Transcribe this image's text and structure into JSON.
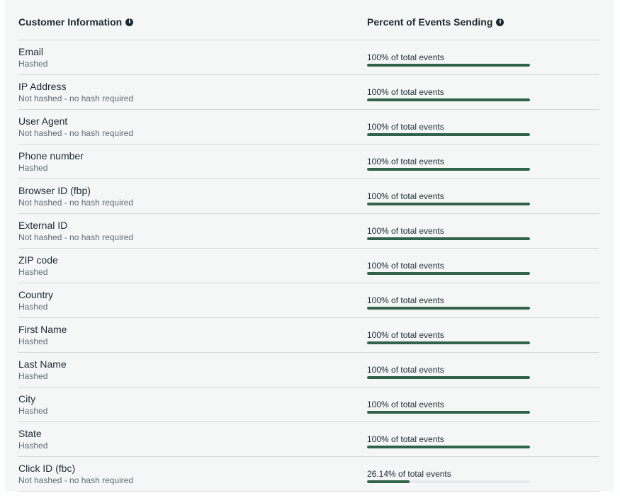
{
  "header": {
    "customer_information": "Customer Information",
    "percent_events_sending": "Percent of Events Sending"
  },
  "colors": {
    "bar_fill": "#31634a",
    "bar_track": "#e7e9eb",
    "panel_background": "#f5f6f6"
  },
  "rows": [
    {
      "name": "Email",
      "hash": "Hashed",
      "percent_text": "100% of total events",
      "fraction": 1.0
    },
    {
      "name": "IP Address",
      "hash": "Not hashed - no hash required",
      "percent_text": "100% of total events",
      "fraction": 1.0
    },
    {
      "name": "User Agent",
      "hash": "Not hashed - no hash required",
      "percent_text": "100% of total events",
      "fraction": 1.0
    },
    {
      "name": "Phone number",
      "hash": "Hashed",
      "percent_text": "100% of total events",
      "fraction": 1.0
    },
    {
      "name": "Browser ID (fbp)",
      "hash": "Not hashed - no hash required",
      "percent_text": "100% of total events",
      "fraction": 1.0
    },
    {
      "name": "External ID",
      "hash": "Not hashed - no hash required",
      "percent_text": "100% of total events",
      "fraction": 1.0
    },
    {
      "name": "ZIP code",
      "hash": "Hashed",
      "percent_text": "100% of total events",
      "fraction": 1.0
    },
    {
      "name": "Country",
      "hash": "Hashed",
      "percent_text": "100% of total events",
      "fraction": 1.0
    },
    {
      "name": "First Name",
      "hash": "Hashed",
      "percent_text": "100% of total events",
      "fraction": 1.0
    },
    {
      "name": "Last Name",
      "hash": "Hashed",
      "percent_text": "100% of total events",
      "fraction": 1.0
    },
    {
      "name": "City",
      "hash": "Hashed",
      "percent_text": "100% of total events",
      "fraction": 1.0
    },
    {
      "name": "State",
      "hash": "Hashed",
      "percent_text": "100% of total events",
      "fraction": 1.0
    },
    {
      "name": "Click ID (fbc)",
      "hash": "Not hashed - no hash required",
      "percent_text": "26.14% of total events",
      "fraction": 0.2614
    }
  ]
}
